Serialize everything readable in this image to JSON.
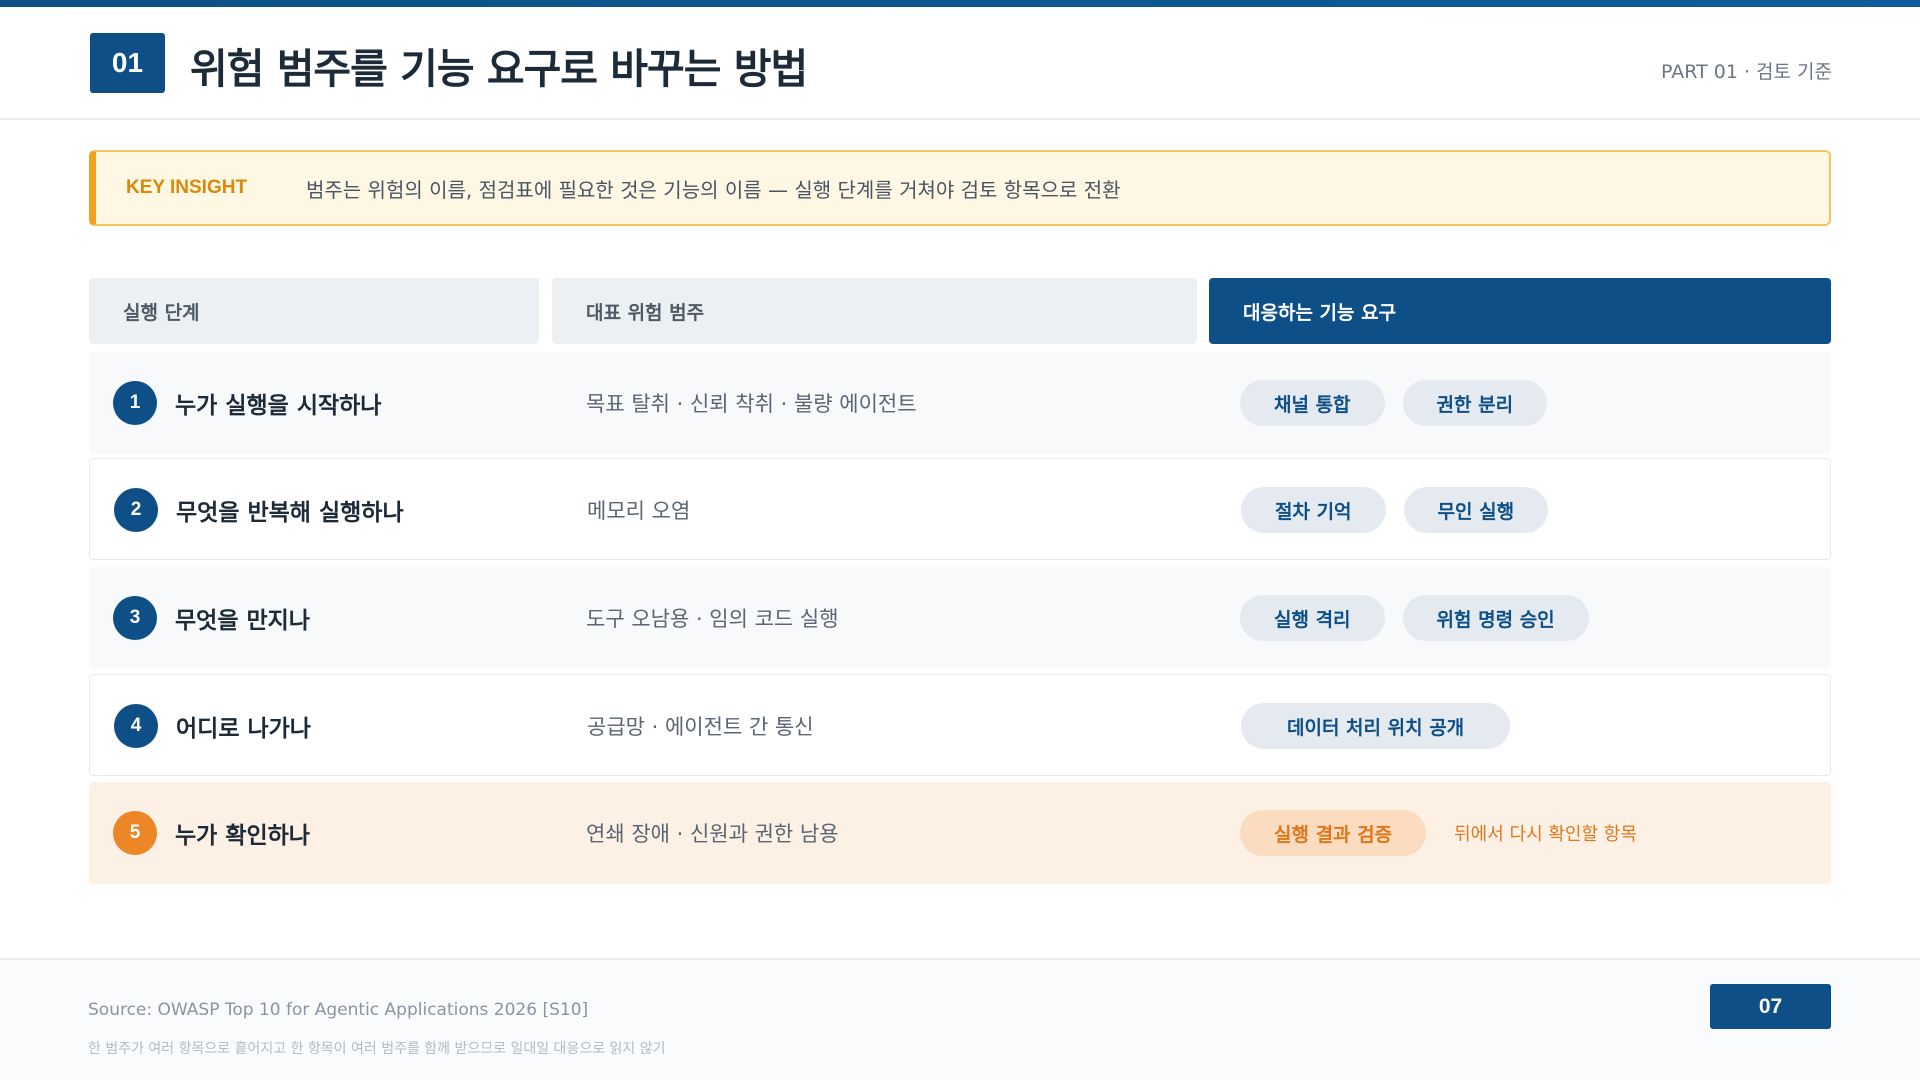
{
  "header": {
    "section_number": "01",
    "title": "위험 범주를 기능 요구로 바꾸는 방법",
    "part_label": "PART 01 · 검토 기준"
  },
  "insight": {
    "key": "KEY INSIGHT",
    "text": "범주는 위험의 이름, 점검표에 필요한 것은 기능의 이름 — 실행 단계를 거쳐야 검토 항목으로 전환"
  },
  "table": {
    "headers": [
      "실행 단계",
      "대표 위험 범주",
      "대응하는 기능 요구"
    ],
    "rows": [
      {
        "num": "1",
        "stage": "누가 실행을 시작하나",
        "risk": "목표 탈취 · 신뢰 착취 · 불량 에이전트",
        "funcs": [
          "채널 통합",
          "권한 분리"
        ]
      },
      {
        "num": "2",
        "stage": "무엇을 반복해 실행하나",
        "risk": "메모리 오염",
        "funcs": [
          "절차 기억",
          "무인 실행"
        ]
      },
      {
        "num": "3",
        "stage": "무엇을 만지나",
        "risk": "도구 오남용 · 임의 코드 실행",
        "funcs": [
          "실행 격리",
          "위험 명령 승인"
        ]
      },
      {
        "num": "4",
        "stage": "어디로 나가나",
        "risk": "공급망 · 에이전트 간 통신",
        "funcs": [
          "데이터 처리 위치 공개"
        ]
      },
      {
        "num": "5",
        "stage": "누가 확인하나",
        "risk": "연쇄 장애 · 신원과 권한 남용",
        "funcs": [
          "실행 결과 검증"
        ],
        "note": "뒤에서 다시 확인할 항목"
      }
    ]
  },
  "footer": {
    "source": "Source: OWASP Top 10 for Agentic Applications 2026 [S10]",
    "footnote": "한 범주가 여러 항목으로 흩어지고 한 항목이 여러 범주를 함께 받으므로 일대일 대응으로 읽지 않기",
    "page_number": "07"
  },
  "colors": {
    "brand": "#0d4f86",
    "accent": "#ec8627",
    "insight_bg": "#fdf7e3",
    "highlight_row": "#fdf1e6"
  }
}
